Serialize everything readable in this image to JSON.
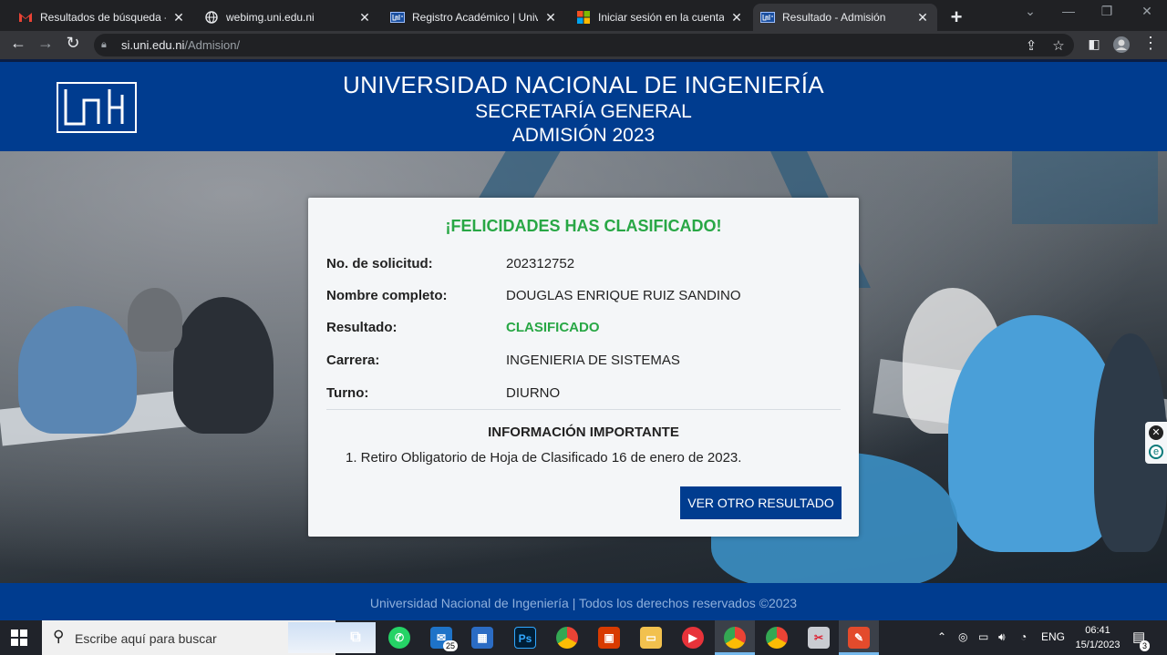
{
  "browser": {
    "tabs": [
      {
        "title": "Resultados de búsqueda - do",
        "icon": "gmail-icon"
      },
      {
        "title": "webimg.uni.edu.ni",
        "icon": "globe-icon"
      },
      {
        "title": "Registro Académico | Univers",
        "icon": "uni-icon"
      },
      {
        "title": "Iniciar sesión en la cuenta",
        "icon": "microsoft-icon"
      },
      {
        "title": "Resultado - Admisión",
        "icon": "uni-icon"
      }
    ],
    "active_tab": 4,
    "url_host": "si.uni.edu.ni",
    "url_path": "/Admision/"
  },
  "header": {
    "line1": "UNIVERSIDAD NACIONAL DE INGENIERÍA",
    "line2": "SECRETARÍA GENERAL",
    "line3": "ADMISIÓN 2023"
  },
  "card": {
    "title": "¡FELICIDADES HAS CLASIFICADO!",
    "fields": [
      {
        "label": "No. de solicitud:",
        "value": "202312752"
      },
      {
        "label": "Nombre completo:",
        "value": "DOUGLAS ENRIQUE RUIZ SANDINO"
      },
      {
        "label": "Resultado:",
        "value": "CLASIFICADO"
      },
      {
        "label": "Carrera:",
        "value": "INGENIERIA DE SISTEMAS"
      },
      {
        "label": "Turno:",
        "value": "DIURNO"
      }
    ],
    "info_title": "INFORMACIÓN IMPORTANTE",
    "info_item": "1. Retiro Obligatorio de Hoja de Clasificado 16 de enero de 2023.",
    "button": "VER OTRO RESULTADO"
  },
  "footer": {
    "text": "Universidad Nacional de Ingeniería | Todos los derechos reservados ©2023"
  },
  "taskbar": {
    "search_placeholder": "Escribe aquí para buscar",
    "mail_badge": "25",
    "language": "ENG",
    "time": "06:41",
    "date": "15/1/2023",
    "notification_count": "3"
  },
  "colors": {
    "brand_blue": "#003c8f",
    "success_green": "#28a745"
  }
}
